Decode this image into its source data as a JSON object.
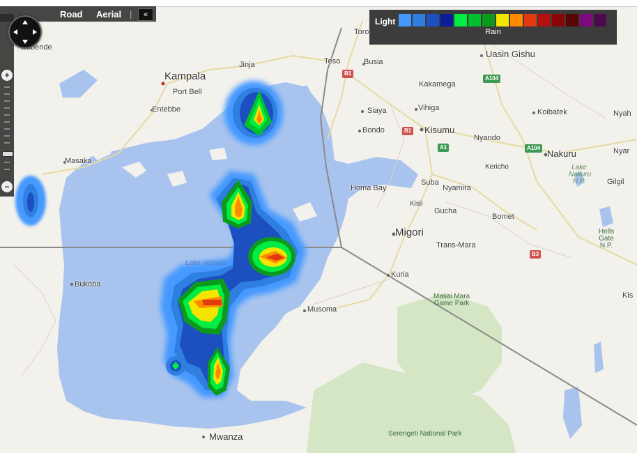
{
  "map_controls": {
    "road_label": "Road",
    "aerial_label": "Aerial",
    "separator": "|",
    "collapse_label": "«",
    "zoom_in_label": "+",
    "zoom_out_label": "−"
  },
  "legend": {
    "title": "Light",
    "subtitle": "Rain",
    "swatches": [
      "#4499ff",
      "#2f7fe0",
      "#1c4fc0",
      "#0a1e9c",
      "#00ee44",
      "#00c030",
      "#0d9a1c",
      "#f5e400",
      "#ff8a00",
      "#e23a10",
      "#b41010",
      "#8a0606",
      "#5a0404",
      "#7c0a7c",
      "#4c0a4c"
    ]
  },
  "places": {
    "wubende": "wubende",
    "kampala": "Kampala",
    "jinja": "Jinja",
    "port_bell": "Port Bell",
    "entebbe": "Entebbe",
    "masaka": "Masaka",
    "bukoba": "Bukoba",
    "mwanza": "Mwanza",
    "musoma": "Musoma",
    "tororo": "Toro",
    "teso": "Teso",
    "busia": "Busia",
    "uasin_gishu": "Uasin Gishu",
    "kakamega": "Kakamega",
    "siaya": "Siaya",
    "vihiga": "Vihiga",
    "koibatek": "Koibatek",
    "nyah": "Nyah",
    "bondo": "Bondo",
    "kisumu": "Kisumu",
    "nyando": "Nyando",
    "nakuru": "Nakuru",
    "nyar": "Nyar",
    "kericho": "Kericho",
    "lake_nakuru_np": "Lake Nakuru N.P.",
    "gilgil": "Gilgil",
    "homa_bay": "Homa Bay",
    "suba": "Suba",
    "nyamira": "Nyamira",
    "kisii": "Kisii",
    "gucha": "Gucha",
    "bomet": "Bomet",
    "migori": "Migori",
    "trans_mara": "Trans-Mara",
    "hells_gate_np": "Hells Gate N.P.",
    "kuria": "Kuria",
    "kis": "Kis",
    "lake_victoria": "Lake Victoria",
    "masai_mara": "Masai Mara Game Park",
    "serengeti": "Serengeti National Park"
  },
  "road_shields": {
    "b1_north": "B1",
    "b1_kisumu": "B1",
    "a1": "A1",
    "a104_north": "A104",
    "a104_south": "A104",
    "b3": "B3"
  },
  "colors": {
    "land": "#f3f1ec",
    "water": "#a8c4ee",
    "park": "#d4e6c3",
    "border": "#8a8a8a",
    "road": "#e6d9a0"
  }
}
